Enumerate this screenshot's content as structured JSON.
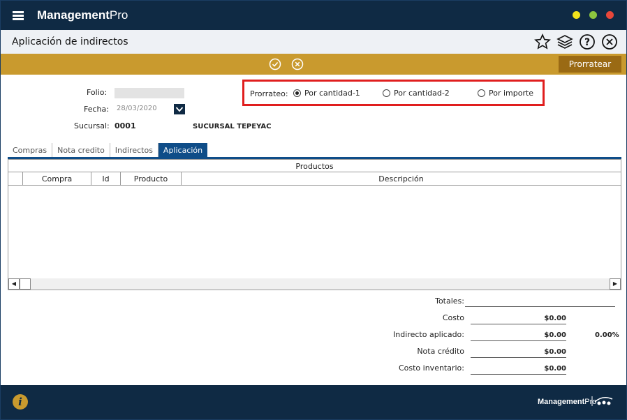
{
  "app": {
    "brand_bold": "Management",
    "brand_light": "Pro"
  },
  "window_controls": {
    "minimize_color": "#f2e21c",
    "maximize_color": "#8cc63f",
    "close_color": "#e8473a"
  },
  "header": {
    "title": "Aplicación de indirectos"
  },
  "actionbar": {
    "prorratear_label": "Prorratear",
    "accent": "#c99a2e"
  },
  "form": {
    "folio_label": "Folio:",
    "folio_value": "",
    "fecha_label": "Fecha:",
    "fecha_value": "28/03/2020",
    "sucursal_label": "Sucursal:",
    "sucursal_code": "0001",
    "sucursal_name": "SUCURSAL TEPEYAC"
  },
  "prorrateo": {
    "label": "Prorrateo:",
    "options": [
      {
        "label": "Por cantidad-1",
        "selected": true
      },
      {
        "label": "Por cantidad-2",
        "selected": false
      },
      {
        "label": "Por importe",
        "selected": false
      }
    ]
  },
  "tabs": [
    {
      "label": "Compras",
      "active": false
    },
    {
      "label": "Nota credito",
      "active": false
    },
    {
      "label": "Indirectos",
      "active": false
    },
    {
      "label": "Aplicación",
      "active": true
    }
  ],
  "grid": {
    "group_header": "Productos",
    "columns": [
      "",
      "Compra",
      "Id",
      "Producto",
      "Descripción"
    ],
    "rows": []
  },
  "totals": {
    "title": "Totales:",
    "costo_label": "Costo",
    "costo_value": "$0.00",
    "indirecto_label": "Indirecto aplicado:",
    "indirecto_value": "$0.00",
    "indirecto_pct": "0.00%",
    "nota_label": "Nota crédito",
    "nota_value": "$0.00",
    "inventario_label": "Costo inventario:",
    "inventario_value": "$0.00"
  },
  "footer": {
    "brand_bold": "Management",
    "brand_light": "Pro"
  }
}
